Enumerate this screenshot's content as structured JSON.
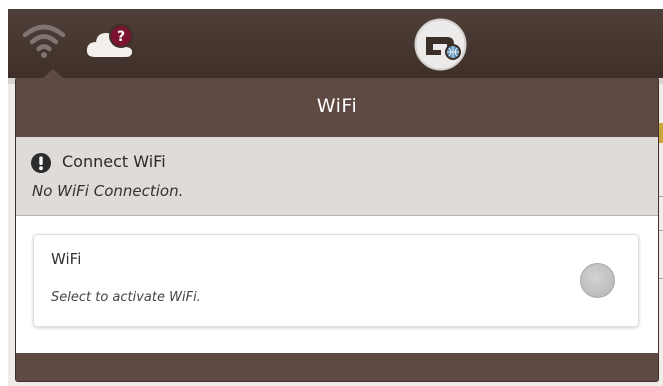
{
  "top_bar": {
    "icons": [
      "wifi-icon",
      "cloud-help-icon",
      "machine-connection-icon"
    ],
    "cloud_badge": "?"
  },
  "panel": {
    "title": "WiFi",
    "status": {
      "icon": "exclamation-icon",
      "title": "Connect WiFi",
      "message": "No WiFi Connection."
    },
    "wifi_card": {
      "title": "WiFi",
      "subtitle": "Select to activate WiFi.",
      "toggle_on": false
    }
  },
  "colors": {
    "top_bar": "#3f3129",
    "panel": "#5e4a42",
    "status_bg": "#dedbd8",
    "card_bg": "#ffffff",
    "toggle_off": "#c4c4c4",
    "badge": "#7a1430"
  }
}
